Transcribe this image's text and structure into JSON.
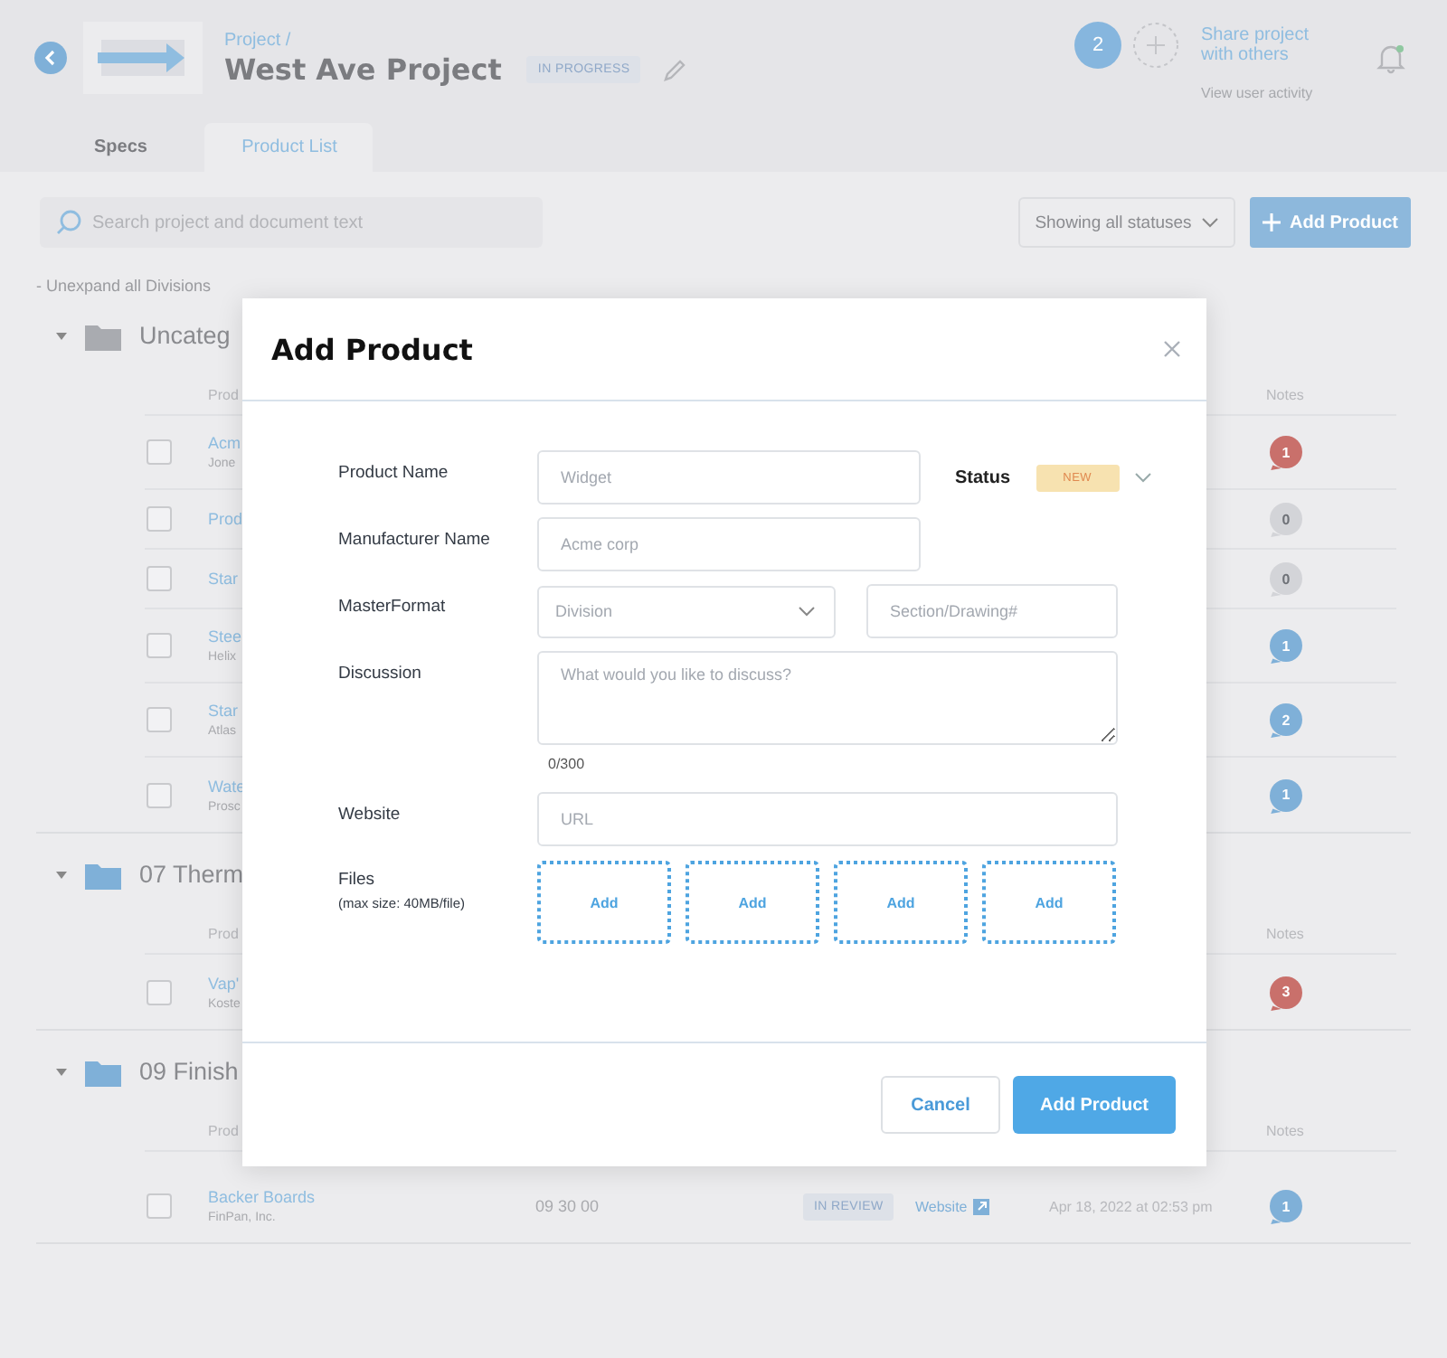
{
  "header": {
    "breadcrumb": "Project /",
    "title": "West Ave Project",
    "status": "IN PROGRESS",
    "member_count": "2",
    "share_link": "Share project with others",
    "activity_link": "View user activity"
  },
  "tabs": [
    {
      "label": "Specs",
      "selected": false
    },
    {
      "label": "Product List",
      "selected": true
    }
  ],
  "toolbar": {
    "search": {
      "placeholder": "Search project and document text"
    },
    "status_filter": "Showing all statuses",
    "add_button": "Add Product"
  },
  "unexpand_link": "- Unexpand all Divisions",
  "divisions": [
    {
      "title": "Uncateg",
      "expanded": true,
      "color": "#a9abb0",
      "columns": [
        "Prod",
        "Notes"
      ],
      "rows": [
        {
          "name": "Acm",
          "company": "Jone",
          "checked": false,
          "notes": "1",
          "color": "#c9706b"
        },
        {
          "name": "Prod",
          "checked": false,
          "notes": "0",
          "color": "#d3d4d8"
        },
        {
          "name": "Star",
          "checked": false,
          "notes": "0",
          "color": "#d3d4d8"
        },
        {
          "name": "Stee",
          "company": "Helix",
          "checked": false,
          "notes": "1",
          "color": "#7fb0d8"
        },
        {
          "name": "Star",
          "company": "Atlas",
          "checked": false,
          "notes": "2",
          "color": "#7fb0d8"
        },
        {
          "name": "Wate",
          "company": "Prosc",
          "checked": false,
          "notes": "1",
          "color": "#7fb0d8"
        }
      ]
    },
    {
      "title": "07 Therm",
      "expanded": true,
      "color": "#7fb0d8",
      "columns": [
        "Prod",
        "Notes"
      ],
      "rows": [
        {
          "name": "Vap'",
          "company": "Koste",
          "checked": false,
          "notes": "3",
          "color": "#c9706b"
        }
      ]
    },
    {
      "title": "09 Finish",
      "expanded": true,
      "color": "#7fb0d8",
      "columns": [
        "Prod",
        "Notes"
      ],
      "rows": [
        {
          "name": "Backer Boards",
          "company": "FinPan, Inc.",
          "code": "09 30 00",
          "status": "IN REVIEW",
          "website": "Website",
          "date": "Apr 18, 2022 at 02:53 pm",
          "checked": false,
          "notes": "1",
          "color": "#7fb0d8"
        }
      ]
    }
  ],
  "modal": {
    "title": "Add Product",
    "product_name": {
      "label": "Product Name",
      "placeholder": "Widget"
    },
    "status": {
      "label": "Status",
      "value": "NEW"
    },
    "manufacturer": {
      "label": "Manufacturer Name",
      "placeholder": "Acme corp"
    },
    "masterformat": {
      "label": "MasterFormat",
      "division_placeholder": "Division",
      "section_placeholder": "Section/Drawing#"
    },
    "discussion": {
      "label": "Discussion",
      "placeholder": "What would you like to discuss?",
      "counter": "0/300"
    },
    "website": {
      "label": "Website",
      "placeholder": "URL"
    },
    "files": {
      "label": "Files",
      "note": "(max size: 40MB/file)",
      "slots": [
        "Add",
        "Add",
        "Add",
        "Add"
      ]
    },
    "buttons": [
      {
        "label": "Cancel",
        "kind": "secondary"
      },
      {
        "label": "Add Product",
        "kind": "primary"
      }
    ]
  }
}
